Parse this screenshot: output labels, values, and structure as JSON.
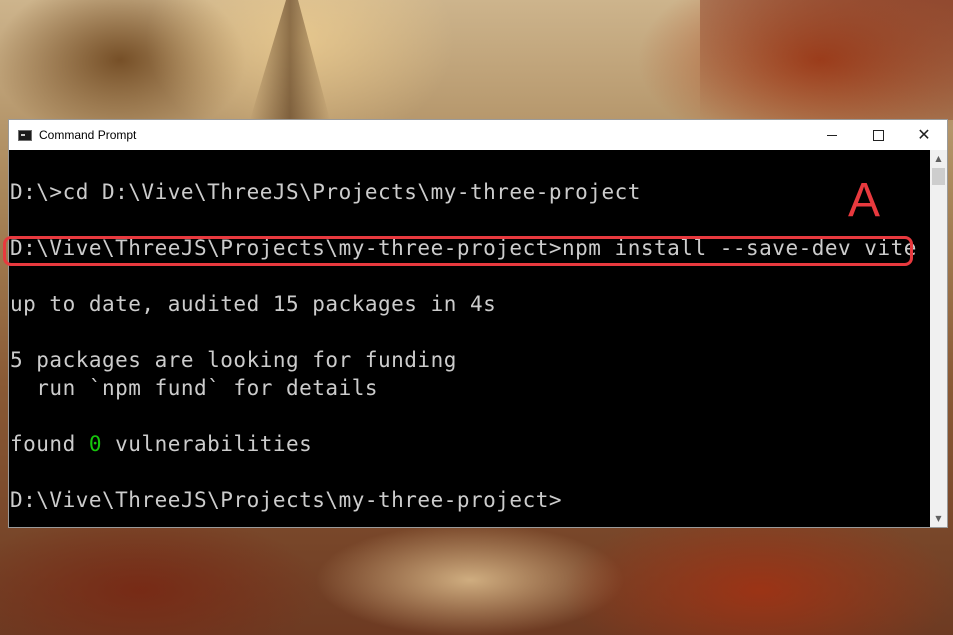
{
  "window": {
    "title": "Command Prompt",
    "app_icon": "console-icon",
    "controls": {
      "minimize_icon": "minimize-icon",
      "maximize_icon": "maximize-icon",
      "close_icon": "close-icon",
      "close_glyph": "✕"
    }
  },
  "console": {
    "lines": [
      "D:\\>cd D:\\Vive\\ThreeJS\\Projects\\my-three-project",
      "D:\\Vive\\ThreeJS\\Projects\\my-three-project>npm install --save-dev vite",
      "up to date, audited 15 packages in 4s",
      "5 packages are looking for funding",
      "  run `npm fund` for details",
      {
        "before": "found ",
        "highlight": "0",
        "after": " vulnerabilities"
      },
      "D:\\Vive\\ThreeJS\\Projects\\my-three-project>"
    ],
    "text_color": "#cccccc",
    "highlight_color": "#16c60c",
    "background": "#000000"
  },
  "scrollbar": {
    "up_glyph": "▲",
    "down_glyph": "▼"
  },
  "annotation": {
    "label": "A",
    "color": "#e8393e"
  }
}
